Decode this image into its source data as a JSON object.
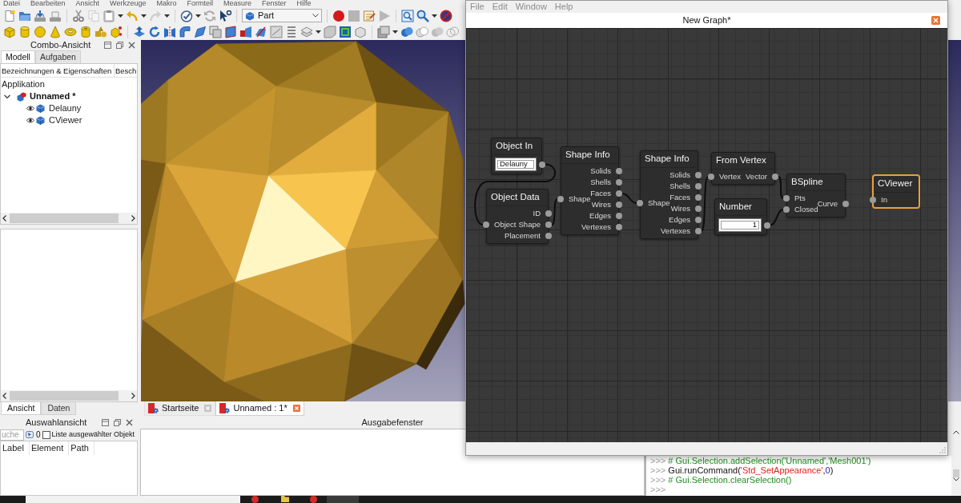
{
  "menu_bar": {
    "items": [
      "Datei",
      "Bearbeiten",
      "Ansicht",
      "Werkzeuge",
      "Makro",
      "Formteil",
      "Measure",
      "Fenster",
      "Hilfe"
    ]
  },
  "toolbar": {
    "workbench": {
      "value": "Part"
    }
  },
  "combo_view": {
    "title": "Combo-Ansicht",
    "tabs": [
      {
        "label": "Modell",
        "selected": true
      },
      {
        "label": "Aufgaben",
        "selected": false
      }
    ],
    "tree": {
      "columns": [
        "Bezeichnungen & Eigenschaften",
        "Besch"
      ],
      "root": "Applikation",
      "documents": [
        {
          "label": "Unnamed *",
          "expanded": true,
          "children": [
            {
              "label": "Delauny"
            },
            {
              "label": "CViewer"
            }
          ]
        }
      ]
    },
    "property_tabs": [
      {
        "label": "Ansicht",
        "selected": true
      },
      {
        "label": "Daten",
        "selected": false
      }
    ]
  },
  "document_tabs": [
    {
      "label": "Startseite",
      "selected": false
    },
    {
      "label": "Unnamed : 1*",
      "selected": true
    }
  ],
  "selection_view": {
    "title": "Auswahlansicht",
    "search": {
      "placeholder": "uche"
    },
    "count": "0",
    "list_checkbox": {
      "label": "Liste ausgewählter Objekt",
      "checked": false
    },
    "columns": [
      "Label",
      "Element",
      "Path"
    ]
  },
  "report_view": {
    "title": "Ausgabefenster"
  },
  "python_console": {
    "lines": [
      [
        {
          "kind": "prompt",
          "text": ">>>"
        },
        {
          "kind": "comment",
          "text": " # Gui.Selection.addSelection('Unnamed','Mesh001')"
        }
      ],
      [
        {
          "kind": "prompt",
          "text": ">>>"
        },
        {
          "kind": "code",
          "text": " Gui.runCommand("
        },
        {
          "kind": "string",
          "text": "'Std_SetAppearance'"
        },
        {
          "kind": "code",
          "text": ","
        },
        {
          "kind": "number",
          "text": "0"
        },
        {
          "kind": "code",
          "text": ")"
        }
      ],
      [
        {
          "kind": "prompt",
          "text": ">>>"
        },
        {
          "kind": "comment",
          "text": " # Gui.Selection.clearSelection()"
        }
      ],
      [
        {
          "kind": "prompt",
          "text": ">>>"
        }
      ]
    ]
  },
  "graph_window": {
    "menu": [
      "File",
      "Edit",
      "Window",
      "Help"
    ],
    "title": "New Graph*",
    "nodes": [
      {
        "kind": "text_field",
        "title": "Object In",
        "value": "Delauny",
        "selected": false
      },
      {
        "kind": "ports",
        "title": "Object Data",
        "inputs": [
          "Object"
        ],
        "outputs": [
          "ID",
          "Shape",
          "Placement"
        ],
        "selected": false
      },
      {
        "kind": "ports",
        "title": "Shape Info",
        "inputs": [
          "Shape"
        ],
        "outputs": [
          "Solids",
          "Shells",
          "Faces",
          "Wires",
          "Edges",
          "Vertexes"
        ],
        "selected": false
      },
      {
        "kind": "ports",
        "title": "Shape Info",
        "inputs": [
          "Shape"
        ],
        "outputs": [
          "Solids",
          "Shells",
          "Faces",
          "Wires",
          "Edges",
          "Vertexes"
        ],
        "selected": false
      },
      {
        "kind": "ports",
        "title": "From Vertex",
        "inputs": [
          "Vertex"
        ],
        "outputs": [
          "Vector"
        ],
        "selected": false
      },
      {
        "kind": "number_field",
        "title": "Number",
        "value": "1",
        "selected": false
      },
      {
        "kind": "ports",
        "title": "BSpline",
        "inputs": [
          "Pts",
          "Closed"
        ],
        "outputs": [
          "Curve"
        ],
        "selected": false
      },
      {
        "kind": "ports",
        "title": "CViewer",
        "inputs": [
          "In"
        ],
        "selected": true
      }
    ]
  }
}
